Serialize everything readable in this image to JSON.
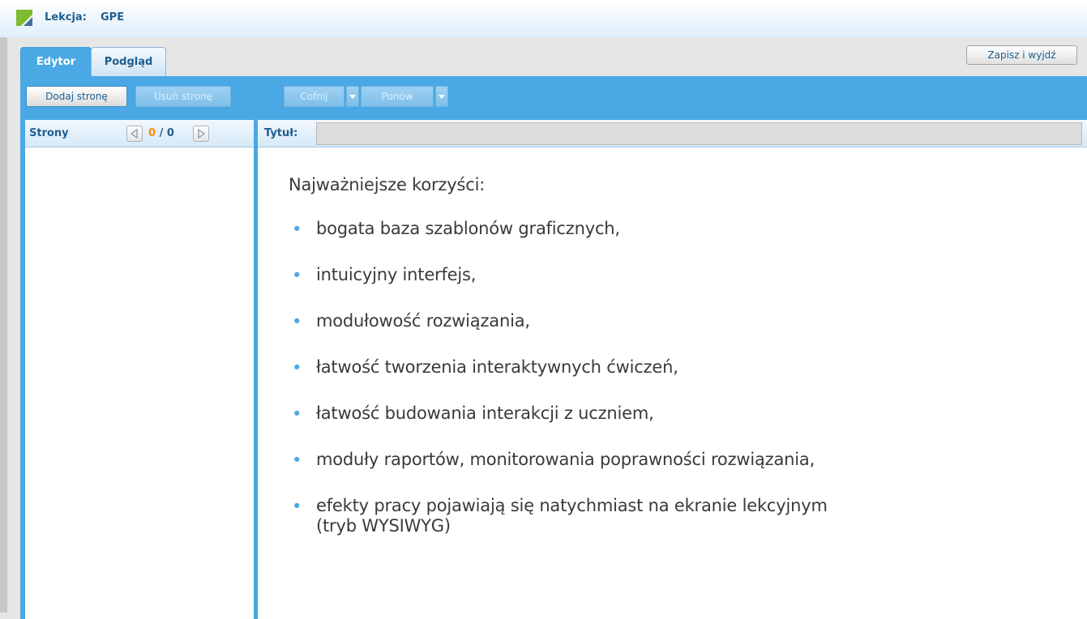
{
  "app": {
    "title_label": "Lekcja:",
    "title_value": "GPE"
  },
  "tabs": [
    {
      "label": "Edytor",
      "active": true
    },
    {
      "label": "Podgląd",
      "active": false
    }
  ],
  "header": {
    "save_exit_label": "Zapisz i wyjdź"
  },
  "toolbar": {
    "add_page": "Dodaj stronę",
    "remove_page": "Usuń stronę",
    "undo": "Cofnij",
    "redo": "Ponów"
  },
  "pages_panel": {
    "label": "Strony",
    "current": "0",
    "separator": " / ",
    "total": "0"
  },
  "editor": {
    "title_label": "Tytuł:",
    "title_value": ""
  },
  "content": {
    "heading": "Najważniejsze korzyści:",
    "bullets": [
      "bogata baza szablonów graficznych,",
      "intuicyjny interfejs,",
      "modułowość rozwiązania,",
      "łatwość tworzenia interaktywnych ćwiczeń,",
      "łatwość budowania interakcji z uczniem,",
      "moduły raportów, monitorowania poprawności rozwiązania,",
      "efekty pracy pojawiają się natychmiast na ekranie lekcyjnym (tryb WYSIWYG)"
    ]
  },
  "colors": {
    "accent": "#4aa8e4",
    "title_text": "#1f5e8e",
    "counter_current": "#ff8a00",
    "logo_green": "#7dbb2f"
  }
}
